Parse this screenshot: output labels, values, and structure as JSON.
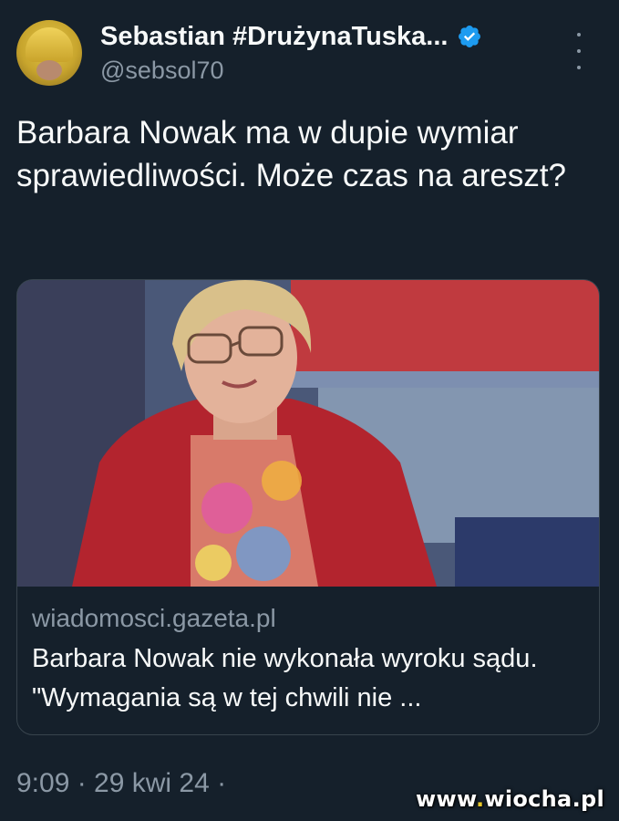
{
  "author": {
    "display_name": "Sebastian #DrużynaTuska...",
    "handle": "@sebsol70"
  },
  "tweet": {
    "text": "Barbara Nowak ma w dupie wymiar sprawiedliwości. Może czas na areszt?",
    "timestamp": "9:09 · 29 kwi 24 ·"
  },
  "link_card": {
    "domain": "wiadomosci.gazeta.pl",
    "title": "Barbara Nowak nie wykonała wyroku sądu. \"Wymagania są w tej chwili nie ..."
  },
  "watermark": {
    "prefix": "www",
    "dot": ".",
    "brand": "wiocha",
    "suffix": ".pl"
  },
  "colors": {
    "background": "#15202b",
    "primary_text": "#f7f9f9",
    "secondary_text": "#8b98a5",
    "verified_badge": "#1d9bf0",
    "card_border": "#38444d"
  },
  "icons": {
    "verified": "verified-badge-icon",
    "more": "more-vertical-icon"
  }
}
